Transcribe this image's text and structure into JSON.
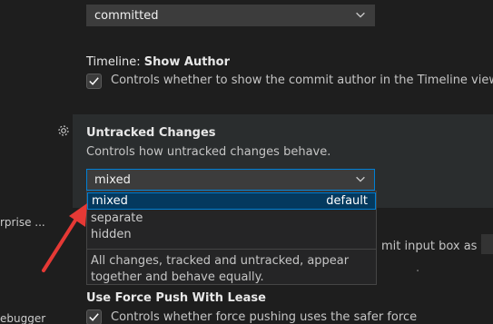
{
  "top_select": {
    "value": "committed"
  },
  "show_author": {
    "title_prefix": "Timeline: ",
    "title_bold": "Show Author",
    "checkbox_label": "Controls whether to show the commit author in the Timeline view."
  },
  "untracked": {
    "title": "Untracked Changes",
    "description": "Controls how untracked changes behave.",
    "select_value": "mixed",
    "options": [
      {
        "label": "mixed",
        "tag": "default"
      },
      {
        "label": "separate",
        "tag": ""
      },
      {
        "label": "hidden",
        "tag": ""
      }
    ],
    "option_description": "All changes, tracked and untracked, appear together and behave equally."
  },
  "background": {
    "commit_text": "mit input box as the d",
    "dot": "."
  },
  "force_push": {
    "title": "Use Force Push With Lease",
    "checkbox_label": "Controls whether force pushing uses the safer force"
  },
  "sidebar": {
    "enterprise": "rprise ...",
    "debugger": "ebugger"
  },
  "colors": {
    "accent": "#007fd4",
    "arrow": "#e53935",
    "selected_bg": "#04395e"
  }
}
